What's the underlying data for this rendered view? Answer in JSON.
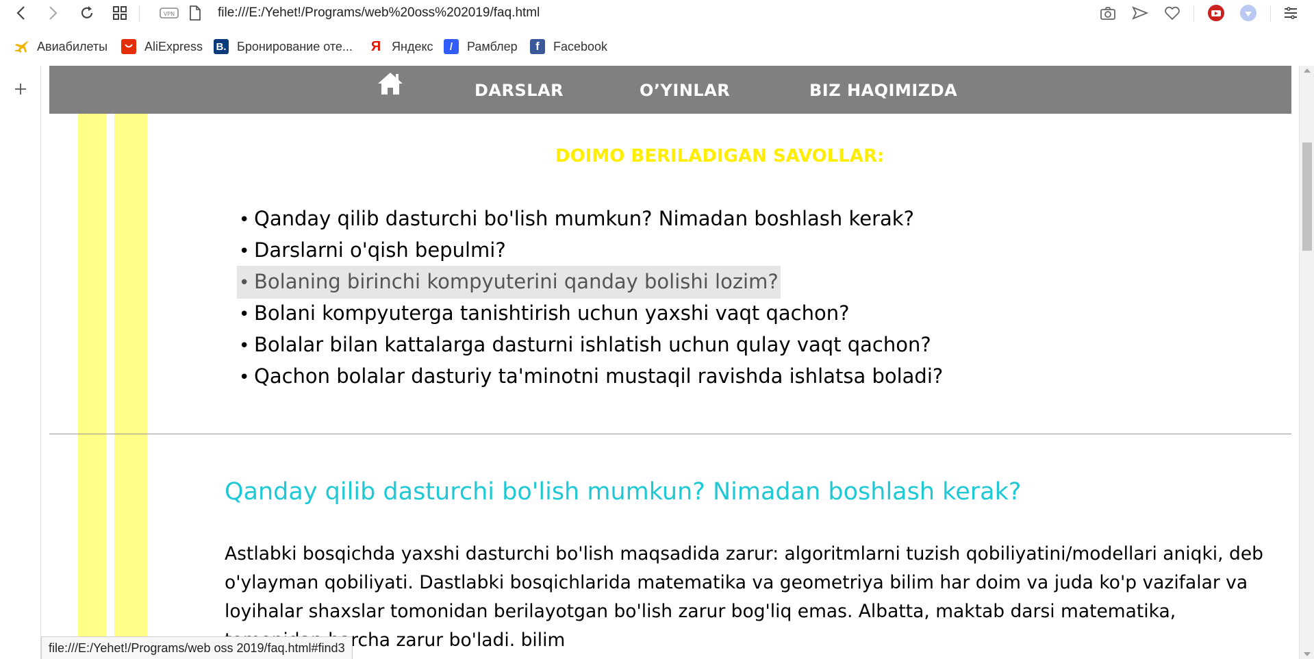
{
  "browser": {
    "url": "file:///E:/Yehet!/Programs/web%20oss%202019/faq.html",
    "status_url": "file:///E:/Yehet!/Programs/web oss 2019/faq.html#find3",
    "vpn_label": "VPN"
  },
  "bookmarks": [
    {
      "label": "Авиабилеты",
      "icon": "airplane-icon"
    },
    {
      "label": "AliExpress",
      "icon": "aliexpress-icon"
    },
    {
      "label": "Бронирование оте...",
      "icon": "booking-icon",
      "glyph": "B."
    },
    {
      "label": "Яндекс",
      "icon": "yandex-icon",
      "glyph": "Я"
    },
    {
      "label": "Рамблер",
      "icon": "rambler-icon",
      "glyph": "/"
    },
    {
      "label": "Facebook",
      "icon": "facebook-icon",
      "glyph": "f"
    }
  ],
  "nav": {
    "items": [
      "DARSLAR",
      "O’YINLAR",
      "BIZ HAQIMIZDA"
    ]
  },
  "faq": {
    "title": "DOIMO BERILADIGAN SAVOLLAR:",
    "bullet": "•",
    "questions": [
      "Qanday qilib dasturchi bo'lish mumkun? Nimadan boshlash kerak?",
      "Darslarni o'qish bepulmi?",
      "Bolaning birinchi kompyuterini qanday bolishi lozim?",
      "Bolani kompyuterga tanishtirish uchun yaxshi vaqt qachon?",
      "Bolalar bilan kattalarga dasturni ishlatish uchun qulay vaqt qachon?",
      "Qachon bolalar dasturiy ta'minotni mustaqil ravishda ishlatsa boladi?"
    ],
    "hovered_index": 2
  },
  "section": {
    "heading": "Qanday qilib dasturchi bo'lish mumkun? Nimadan boshlash kerak?",
    "answer": "Astlabki bosqichda yaxshi dasturchi bo'lish maqsadida zarur: algoritmlarni tuzish qobiliyatini/modellari aniqki, deb o'ylayman qobiliyati. Dastlabki bosqichlarida matematika va geometriya bilim har doim va juda ko'p vazifalar va loyihalar shaxslar tomonidan berilayotgan bo'lish zarur bog'liq emas. Albatta, maktab darsi matematika, tomonidan barcha zarur bo'ladi. bilim"
  },
  "colors": {
    "nav_bg": "#808080",
    "stripe": "#ffff88",
    "faq_title": "#ffee00",
    "heading": "#1ec8d4"
  }
}
